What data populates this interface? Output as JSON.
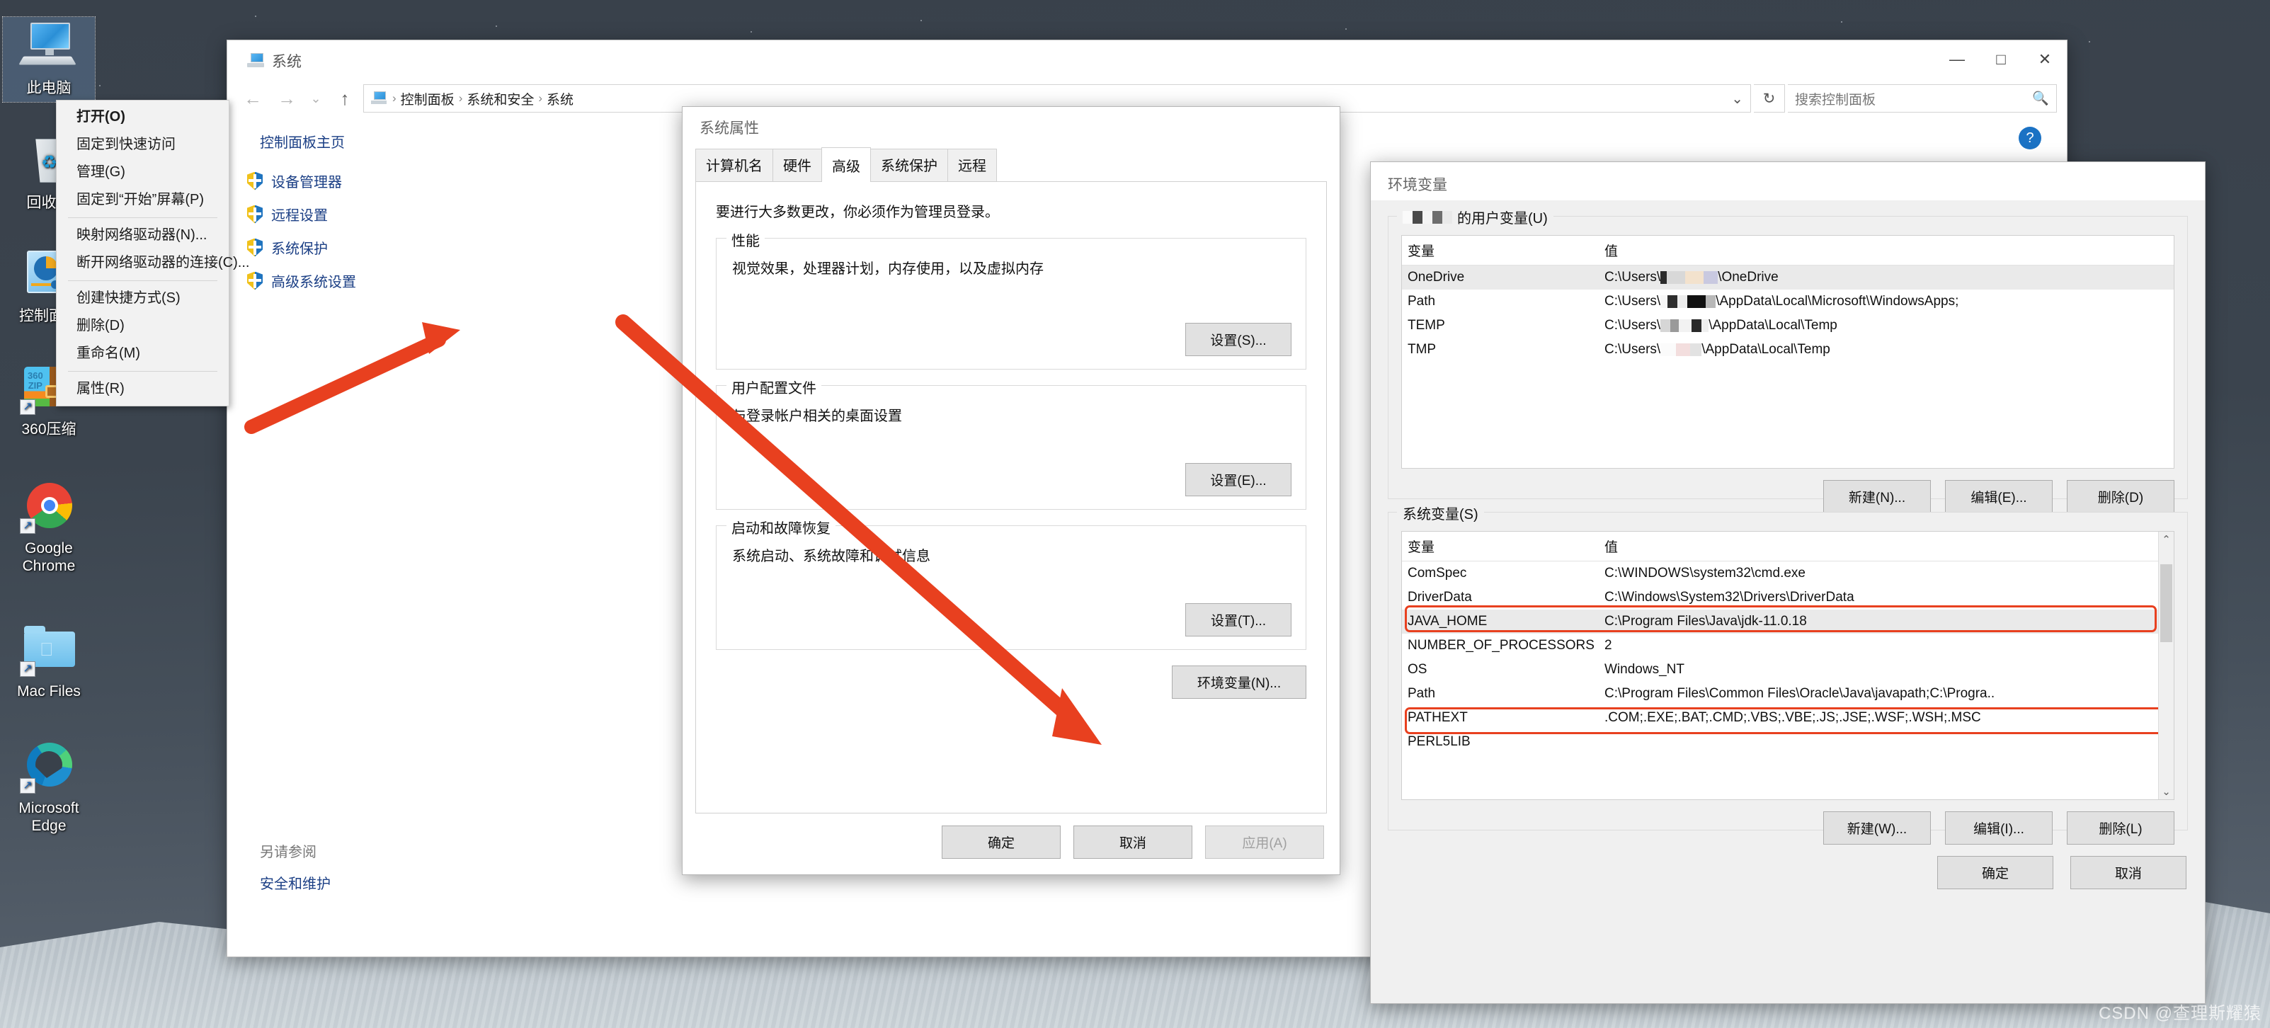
{
  "desktop": {
    "icons": [
      {
        "label": "此电脑",
        "icon": "this-pc-icon",
        "selected": true
      },
      {
        "label": "回收站",
        "icon": "recycle-bin-icon",
        "selected": false
      },
      {
        "label": "控制面板",
        "icon": "control-panel-icon",
        "selected": false
      },
      {
        "label": "360压缩",
        "icon": "360zip-icon",
        "selected": false
      },
      {
        "label": "Google Chrome",
        "icon": "chrome-icon",
        "selected": false
      },
      {
        "label": "Mac Files",
        "icon": "mac-folder-icon",
        "selected": false
      },
      {
        "label": "Microsoft Edge",
        "icon": "edge-icon",
        "selected": false
      }
    ],
    "zip_brand": "360",
    "zip_sub": "ZIP"
  },
  "context_menu": {
    "items": [
      {
        "label": "打开(O)",
        "bold": true
      },
      {
        "label": "固定到快速访问",
        "bold": false
      },
      {
        "label": "管理(G)",
        "bold": false
      },
      {
        "label": "固定到“开始”屏幕(P)",
        "bold": false
      },
      {
        "separator": true
      },
      {
        "label": "映射网络驱动器(N)...",
        "bold": false
      },
      {
        "label": "断开网络驱动器的连接(C)...",
        "bold": false
      },
      {
        "separator": true
      },
      {
        "label": "创建快捷方式(S)",
        "bold": false
      },
      {
        "label": "删除(D)",
        "bold": false
      },
      {
        "label": "重命名(M)",
        "bold": false
      },
      {
        "separator": true
      },
      {
        "label": "属性(R)",
        "bold": false
      }
    ]
  },
  "control_panel": {
    "title": "系统",
    "window_controls": {
      "minimize": "—",
      "maximize": "□",
      "close": "✕"
    },
    "nav": {
      "back": "←",
      "forward": "→",
      "history": "⌄",
      "up": "↑"
    },
    "breadcrumb": [
      "控制面板",
      "系统和安全",
      "系统"
    ],
    "breadcrumb_separator": "›",
    "address_dropdown": "⌄",
    "refresh": "↻",
    "search_placeholder": "搜索控制面板",
    "search_icon": "🔍",
    "help_label": "?",
    "sidebar": {
      "home": "控制面板主页",
      "items": [
        {
          "label": "设备管理器"
        },
        {
          "label": "远程设置"
        },
        {
          "label": "系统保护"
        },
        {
          "label": "高级系统设置"
        }
      ]
    },
    "see_also": {
      "title": "另请参阅",
      "links": [
        "安全和维护"
      ]
    }
  },
  "system_properties": {
    "title": "系统属性",
    "close": "✕",
    "tabs": [
      {
        "label": "计算机名",
        "active": false
      },
      {
        "label": "硬件",
        "active": false
      },
      {
        "label": "高级",
        "active": true
      },
      {
        "label": "系统保护",
        "active": false
      },
      {
        "label": "远程",
        "active": false
      }
    ],
    "note": "要进行大多数更改，你必须作为管理员登录。",
    "groups": [
      {
        "legend": "性能",
        "desc": "视觉效果，处理器计划，内存使用，以及虚拟内存",
        "button": "设置(S)..."
      },
      {
        "legend": "用户配置文件",
        "desc": "与登录帐户相关的桌面设置",
        "button": "设置(E)..."
      },
      {
        "legend": "启动和故障恢复",
        "desc": "系统启动、系统故障和调试信息",
        "button": "设置(T)..."
      }
    ],
    "env_button": "环境变量(N)...",
    "footer": [
      {
        "label": "确定",
        "disabled": false
      },
      {
        "label": "取消",
        "disabled": false
      },
      {
        "label": "应用(A)",
        "disabled": true
      }
    ]
  },
  "environment_variables": {
    "title": "环境变量",
    "close": "✕",
    "user_section": {
      "legend_suffix": "的用户变量(U)",
      "columns": [
        "变量",
        "值"
      ],
      "rows": [
        {
          "name": "OneDrive",
          "value_prefix": "C:\\Users\\",
          "value_suffix": "\\OneDrive",
          "selected": true
        },
        {
          "name": "Path",
          "value_prefix": "C:\\Users\\",
          "value_suffix": "\\AppData\\Local\\Microsoft\\WindowsApps;",
          "selected": false
        },
        {
          "name": "TEMP",
          "value_prefix": "C:\\Users\\",
          "value_suffix": "\\AppData\\Local\\Temp",
          "selected": false
        },
        {
          "name": "TMP",
          "value_prefix": "C:\\Users\\",
          "value_suffix": "\\AppData\\Local\\Temp",
          "selected": false
        }
      ],
      "buttons": [
        "新建(N)...",
        "编辑(E)...",
        "删除(D)"
      ]
    },
    "system_section": {
      "legend": "系统变量(S)",
      "columns": [
        "变量",
        "值"
      ],
      "rows": [
        {
          "name": "ComSpec",
          "value": "C:\\WINDOWS\\system32\\cmd.exe",
          "highlighted": false,
          "selected": false
        },
        {
          "name": "DriverData",
          "value": "C:\\Windows\\System32\\Drivers\\DriverData",
          "highlighted": false,
          "selected": false
        },
        {
          "name": "JAVA_HOME",
          "value": "C:\\Program Files\\Java\\jdk-11.0.18",
          "highlighted": true,
          "selected": true
        },
        {
          "name": "NUMBER_OF_PROCESSORS",
          "value": "2",
          "highlighted": false,
          "selected": false
        },
        {
          "name": "OS",
          "value": "Windows_NT",
          "highlighted": false,
          "selected": false
        },
        {
          "name": "Path",
          "value": "C:\\Program Files\\Common Files\\Oracle\\Java\\javapath;C:\\Progra..",
          "highlighted": true,
          "selected": false
        },
        {
          "name": "PATHEXT",
          "value": ".COM;.EXE;.BAT;.CMD;.VBS;.VBE;.JS;.JSE;.WSF;.WSH;.MSC",
          "highlighted": false,
          "selected": false
        },
        {
          "name": "PERL5LIB",
          "value": "",
          "highlighted": false,
          "selected": false
        }
      ],
      "buttons": [
        "新建(W)...",
        "编辑(I)...",
        "删除(L)"
      ],
      "scroll_up": "⌃",
      "scroll_down": "⌄"
    },
    "footer": [
      "确定",
      "取消"
    ]
  },
  "watermark": "CSDN @查理斯耀猿",
  "colors": {
    "accent_blue": "#1b72c4",
    "link_blue": "#1b3f85",
    "annotation_red": "#e8401f",
    "highlight_red": "#e8401f"
  }
}
